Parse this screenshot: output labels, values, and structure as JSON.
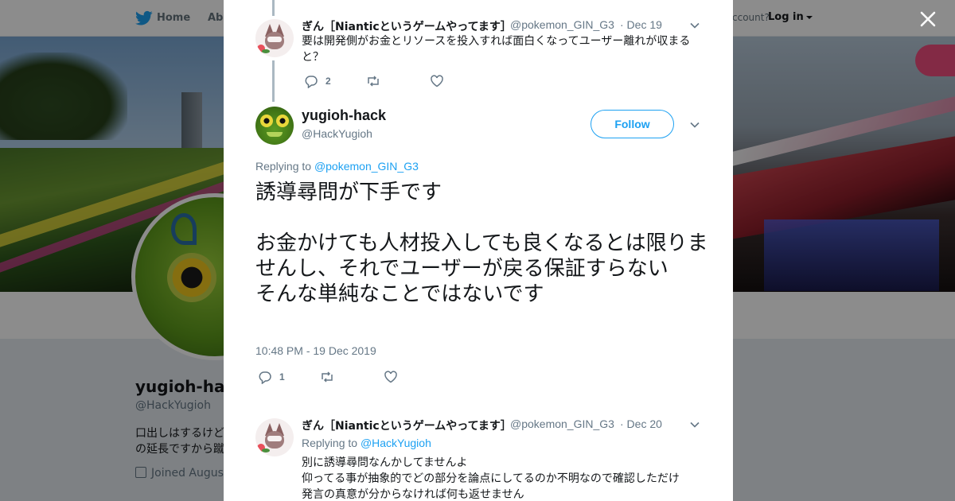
{
  "nav": {
    "home": "Home",
    "about": "Abo",
    "account_prompt": "ccount?",
    "login": "Log in"
  },
  "profile": {
    "name": "yugioh-hac",
    "handle": "@HackYugioh",
    "bio_line1": "口出しはするけど",
    "bio_line2": "の延長ですから蹴",
    "joined": "Joined August"
  },
  "colors": {
    "twitter_blue": "#1da1f2",
    "text_primary": "#14171a",
    "text_secondary": "#657786",
    "thread_line": "#aab8c2"
  },
  "modal": {
    "tweet1": {
      "name": "ぎん［Nianticというゲームやってます］",
      "handle": "@pokemon_GIN_G3",
      "date": "· Dec 19",
      "text": "要は開発側がお金とリソースを投入すれば面白くなってユーザー離れが収まると？",
      "reply_count": "2",
      "icons": [
        "reply-icon",
        "retweet-icon",
        "like-icon",
        "chevron-down-icon"
      ]
    },
    "main_tweet": {
      "name": "yugioh-hack",
      "handle": "@HackYugioh",
      "follow_label": "Follow",
      "replying_prefix": "Replying to",
      "replying_to": "@pokemon_GIN_G3",
      "text": "誘導尋問が下手です\n\nお金かけても人材投入しても良くなるとは限りませんし、それでユーザーが戻る保証すらない\nそんな単純なことではないです",
      "timestamp": "10:48 PM - 19 Dec 2019",
      "reply_count": "1"
    },
    "tweet3": {
      "name": "ぎん［Nianticというゲームやってます］",
      "handle": "@pokemon_GIN_G3",
      "date": "· Dec 20",
      "replying_prefix": "Replying to",
      "replying_to": "@HackYugioh",
      "line1": "別に誘導尋問なんかしてませんよ",
      "line2": "仰ってる事が抽象的でどの部分を論点にしてるのか不明なので確認しただけ",
      "line3": "発言の真意が分からなければ何も返せません"
    }
  }
}
